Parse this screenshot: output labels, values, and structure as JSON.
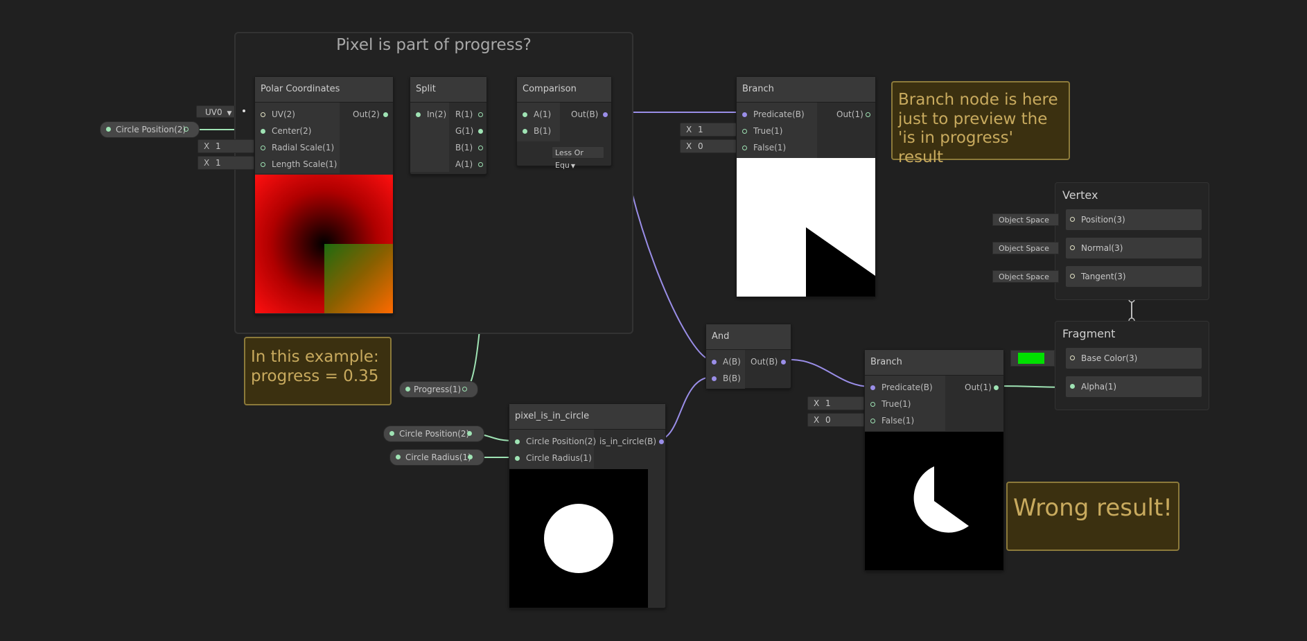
{
  "group": {
    "title": "Pixel is part of progress?"
  },
  "polar": {
    "title": "Polar Coordinates",
    "inputs": [
      "UV(2)",
      "Center(2)",
      "Radial Scale(1)",
      "Length Scale(1)"
    ],
    "output": "Out(2)",
    "uv_dropdown": "UV0",
    "radial_x": "X",
    "radial_value": "1",
    "length_x": "X",
    "length_value": "1"
  },
  "circle_pos_prop_1": "Circle Position(2)",
  "split": {
    "title": "Split",
    "input": "In(2)",
    "outputs": [
      "R(1)",
      "G(1)",
      "B(1)",
      "A(1)"
    ]
  },
  "comparison": {
    "title": "Comparison",
    "inputs": [
      "A(1)",
      "B(1)"
    ],
    "output": "Out(B)",
    "mode": "Less Or Equ"
  },
  "branch1": {
    "title": "Branch",
    "inputs": [
      "Predicate(B)",
      "True(1)",
      "False(1)"
    ],
    "output": "Out(1)",
    "true_x": "X",
    "true_value": "1",
    "false_x": "X",
    "false_value": "0"
  },
  "note_branch": {
    "text": "Branch node is here just to preview the 'is in progress' result"
  },
  "note_example": {
    "line1": "In this example:",
    "line2": "progress = 0.35"
  },
  "progress_prop": "Progress(1)",
  "and_node": {
    "title": "And",
    "inputs": [
      "A(B)",
      "B(B)"
    ],
    "output": "Out(B)"
  },
  "circle_node": {
    "title": "pixel_is_in_circle",
    "inputs": [
      "Circle Position(2)",
      "Circle Radius(1)"
    ],
    "output": "is_in_circle(B)"
  },
  "circle_pos_prop_2": "Circle Position(2)",
  "circle_radius_prop": "Circle Radius(1)",
  "branch2": {
    "title": "Branch",
    "inputs": [
      "Predicate(B)",
      "True(1)",
      "False(1)"
    ],
    "output": "Out(1)",
    "true_x": "X",
    "true_value": "1",
    "false_x": "X",
    "false_value": "0"
  },
  "note_wrong": {
    "text": "Wrong result!"
  },
  "vertex": {
    "title": "Vertex",
    "slots": [
      "Position(3)",
      "Normal(3)",
      "Tangent(3)"
    ],
    "space_labels": [
      "Object Space",
      "Object Space",
      "Object Space"
    ]
  },
  "fragment": {
    "title": "Fragment",
    "slots": [
      "Base Color(3)",
      "Alpha(1)"
    ],
    "base_color_swatch": "#00e000"
  },
  "colors": {
    "float_wire": "#9fe3b4",
    "bool_wire": "#9a8ee8",
    "note_text": "#c8aa5e"
  }
}
